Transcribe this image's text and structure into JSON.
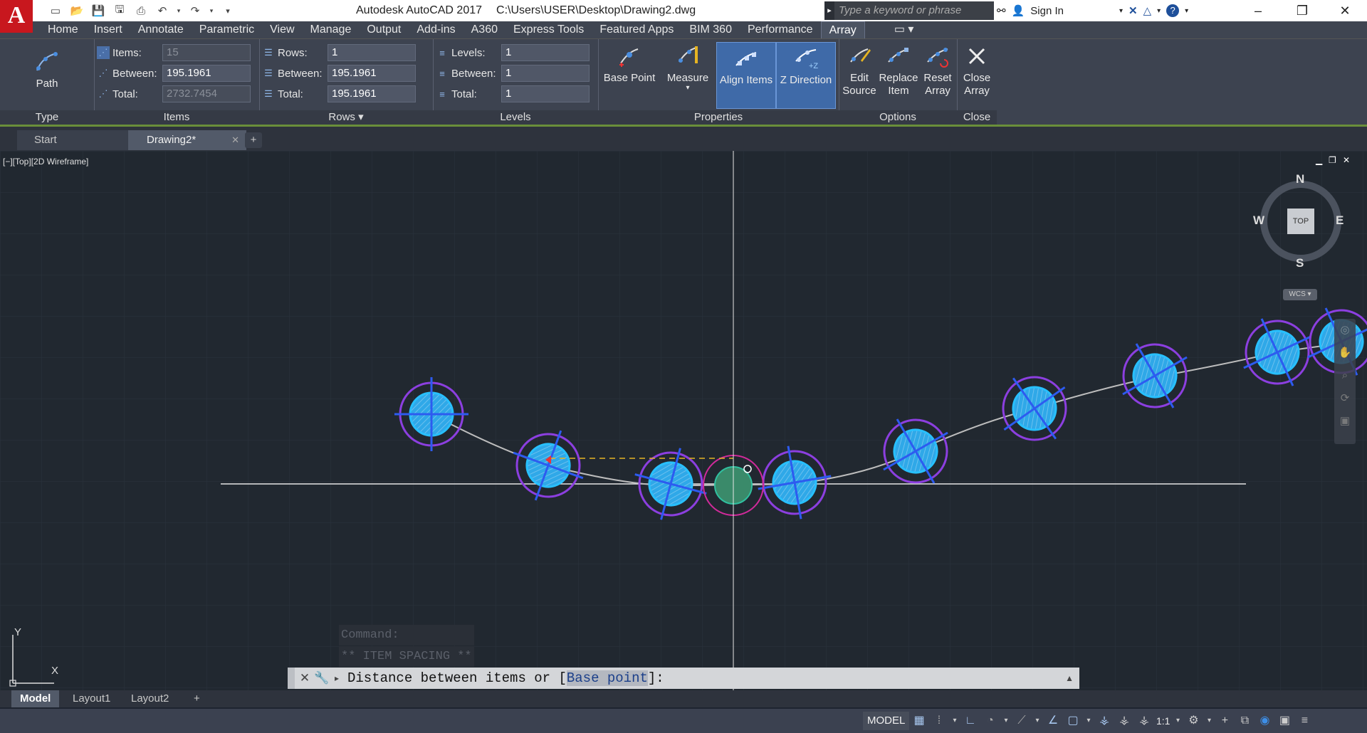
{
  "app": {
    "logo_letter": "A",
    "title": "Autodesk AutoCAD 2017",
    "file_path": "C:\\Users\\USER\\Desktop\\Drawing2.dwg",
    "search_placeholder": "Type a keyword or phrase",
    "sign_in": "Sign In"
  },
  "menu": [
    "Home",
    "Insert",
    "Annotate",
    "Parametric",
    "View",
    "Manage",
    "Output",
    "Add-ins",
    "A360",
    "Express Tools",
    "Featured Apps",
    "BIM 360",
    "Performance",
    "Array"
  ],
  "menu_active_index": 13,
  "ribbon": {
    "type_panel": {
      "label": "Type",
      "button": "Path"
    },
    "items_panel": {
      "label": "Items",
      "items_label": "Items:",
      "items_value": "15",
      "between_label": "Between:",
      "between_value": "195.1961",
      "total_label": "Total:",
      "total_value": "2732.7454"
    },
    "rows_panel": {
      "label": "Rows ▾",
      "rows_label": "Rows:",
      "rows_value": "1",
      "between_label": "Between:",
      "between_value": "195.1961",
      "total_label": "Total:",
      "total_value": "195.1961"
    },
    "levels_panel": {
      "label": "Levels",
      "levels_label": "Levels:",
      "levels_value": "1",
      "between_label": "Between:",
      "between_value": "1",
      "total_label": "Total:",
      "total_value": "1"
    },
    "properties_panel": {
      "label": "Properties",
      "base_point": "Base Point",
      "measure": "Measure",
      "align_items": "Align Items",
      "z_direction": "Z Direction"
    },
    "options_panel": {
      "label": "Options",
      "edit_source_1": "Edit",
      "edit_source_2": "Source",
      "replace_item_1": "Replace",
      "replace_item_2": "Item",
      "reset_array_1": "Reset",
      "reset_array_2": "Array"
    },
    "close_panel": {
      "label": "Close",
      "close_1": "Close",
      "close_2": "Array"
    }
  },
  "tabs": {
    "start": "Start",
    "drawing": "Drawing2*"
  },
  "viewport": {
    "label": "[−][Top][2D Wireframe]",
    "viewcube": {
      "n": "N",
      "s": "S",
      "e": "E",
      "w": "W",
      "top": "TOP",
      "wcs": "WCS ▾"
    },
    "ucs": {
      "y": "Y",
      "x": "X"
    }
  },
  "command": {
    "history": [
      "Command:",
      "** ITEM SPACING **"
    ],
    "prompt_before": "Distance between items or [",
    "prompt_hl": "Base point",
    "prompt_after": "]:"
  },
  "layouts": [
    "Model",
    "Layout1",
    "Layout2"
  ],
  "status": {
    "model": "MODEL",
    "scale": "1:1"
  }
}
